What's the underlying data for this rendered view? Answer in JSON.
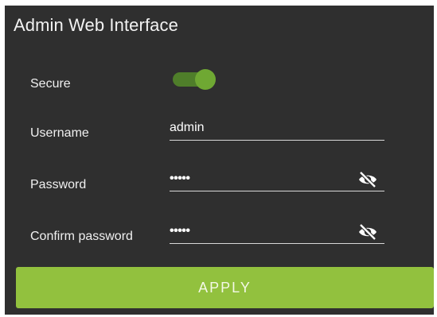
{
  "window": {
    "title": "Admin Web Interface"
  },
  "form": {
    "secure": {
      "label": "Secure",
      "enabled": true
    },
    "username": {
      "label": "Username",
      "value": "admin"
    },
    "password": {
      "label": "Password",
      "masked_value": "•••••",
      "icon": "eye-slash-icon"
    },
    "confirm_password": {
      "label": "Confirm password",
      "masked_value": "•••••",
      "icon": "eye-slash-icon"
    }
  },
  "actions": {
    "apply_label": "APPLY"
  },
  "colors": {
    "panel_bg": "#2f2f2f",
    "toggle_track": "#4f7e2a",
    "toggle_thumb": "#6fa833",
    "apply_bg": "#92c13e"
  }
}
